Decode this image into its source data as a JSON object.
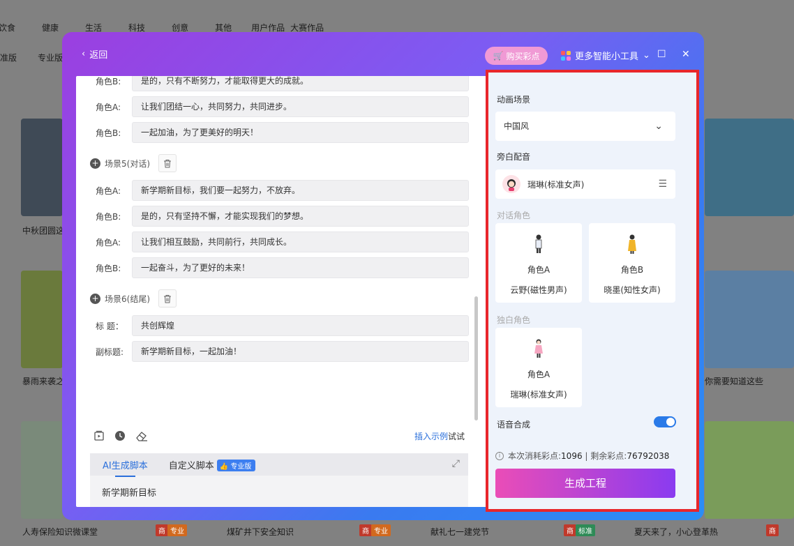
{
  "background": {
    "nav": [
      "饮食",
      "健康",
      "生活",
      "科技",
      "创意",
      "其他",
      "用户作品",
      "大赛作品"
    ],
    "sub": [
      "准版",
      "专业版"
    ],
    "captions": [
      "中秋团圆这",
      "暴雨来袭之",
      "人寿保险知识微课堂",
      "煤矿井下安全知识",
      "献礼七一建党节",
      "夏天来了，小心登革热",
      "你需要知道这些"
    ],
    "tags": {
      "shang": "商",
      "pro": "专业",
      "std": "标准"
    }
  },
  "modal": {
    "back_label": "返回",
    "buy_label": "购买彩点",
    "tools_label": "更多智能小工具",
    "rows": [
      {
        "label": "角色B:",
        "text": "是的，只有不断努力，才能取得更大的成就。"
      },
      {
        "label": "角色A:",
        "text": "让我们团结一心，共同努力，共同进步。"
      },
      {
        "label": "角色B:",
        "text": "一起加油，为了更美好的明天！"
      }
    ],
    "scene5": "场景5(对话)",
    "rows5": [
      {
        "label": "角色A:",
        "text": "新学期新目标，我们要一起努力，不放弃。"
      },
      {
        "label": "角色B:",
        "text": "是的，只有坚持不懈，才能实现我们的梦想。"
      },
      {
        "label": "角色A:",
        "text": "让我们相互鼓励，共同前行，共同成长。"
      },
      {
        "label": "角色B:",
        "text": "一起奋斗，为了更好的未来！"
      }
    ],
    "scene6": "场景6(结尾)",
    "title_label": "标 题：",
    "title_text": "共创辉煌",
    "subtitle_label": "副标题:",
    "subtitle_text": "新学期新目标，一起加油！",
    "insert_example": "插入示例",
    "try": "试试",
    "tab_ai": "AI生成脚本",
    "tab_custom": "自定义脚本",
    "pro_badge": "专业版",
    "prompt": "新学期新目标"
  },
  "panel": {
    "anim_scene_label": "动画场景",
    "anim_scene_value": "中国风",
    "narration_label": "旁白配音",
    "narration_voice": "瑞琳(标准女声)",
    "dialog_label": "对话角色",
    "roleA": {
      "name": "角色A",
      "voice": "云野(磁性男声)"
    },
    "roleB": {
      "name": "角色B",
      "voice": "晓墨(知性女声)"
    },
    "mono_label": "独白角色",
    "monoA": {
      "name": "角色A",
      "voice": "瑞琳(标准女声)"
    },
    "tts_label": "语音合成",
    "tts_on": true,
    "cost_prefix": "本次消耗彩点:",
    "cost_value": "1096",
    "remain_prefix": " | 剩余彩点:",
    "remain_value": "76792038",
    "generate_label": "生成工程"
  },
  "colors": {
    "accent": "#2a6fdb",
    "highlight": "#e8262b",
    "generate_from": "#ea4db7",
    "generate_to": "#8a3bf0"
  }
}
